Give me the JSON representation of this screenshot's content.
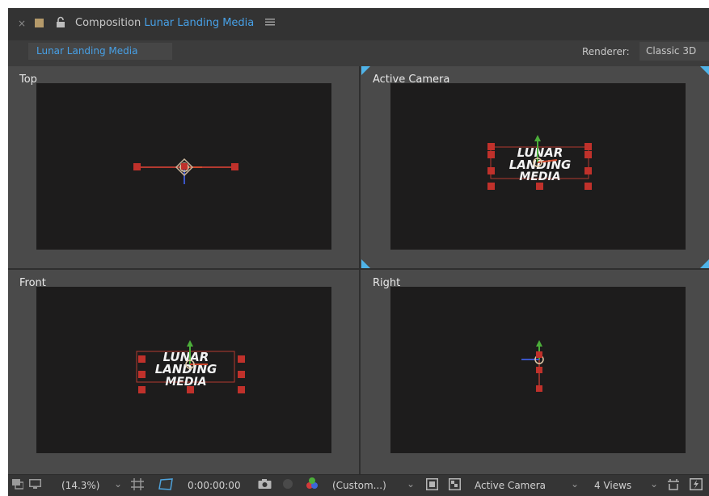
{
  "header": {
    "close": "×",
    "label": "Composition",
    "composition_name": "Lunar Landing Media",
    "menu_icon": "hamburger-menu-icon"
  },
  "tab": {
    "label": "Lunar Landing Media"
  },
  "renderer": {
    "label": "Renderer:",
    "value": "Classic 3D"
  },
  "views": [
    {
      "label": "Top"
    },
    {
      "label": "Active Camera"
    },
    {
      "label": "Front"
    },
    {
      "label": "Right"
    }
  ],
  "layer_text": [
    "LUNAR",
    "LANDING",
    "MEDIA"
  ],
  "toolbar": {
    "zoom": "(14.3%)",
    "timecode": "0:00:00:00",
    "resolution": "(Custom...)",
    "active_view": "Active Camera",
    "view_layout": "4 Views"
  },
  "colors": {
    "accent": "#47a0e6",
    "handle": "#c0312b",
    "panel_bg": "#3c3c3c",
    "viewer_bg": "#1d1c1c"
  }
}
